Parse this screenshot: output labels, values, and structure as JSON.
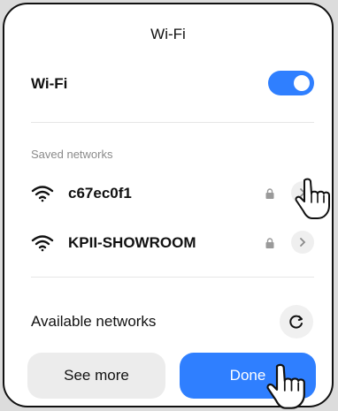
{
  "dialog": {
    "title": "Wi-Fi",
    "wifi_toggle_label": "Wi-Fi",
    "wifi_enabled": true,
    "saved_section_label": "Saved networks",
    "saved_networks": [
      {
        "name": "c67ec0f1",
        "secured": true
      },
      {
        "name": "KPII-SHOWROOM",
        "secured": true
      }
    ],
    "available_label": "Available networks",
    "buttons": {
      "see_more": "See more",
      "done": "Done"
    }
  },
  "colors": {
    "accent": "#2f7fff",
    "secondary_button": "#ececec"
  },
  "icons": [
    "wifi-icon",
    "lock-icon",
    "chevron-right-icon",
    "refresh-icon",
    "hand-pointer-icon"
  ]
}
